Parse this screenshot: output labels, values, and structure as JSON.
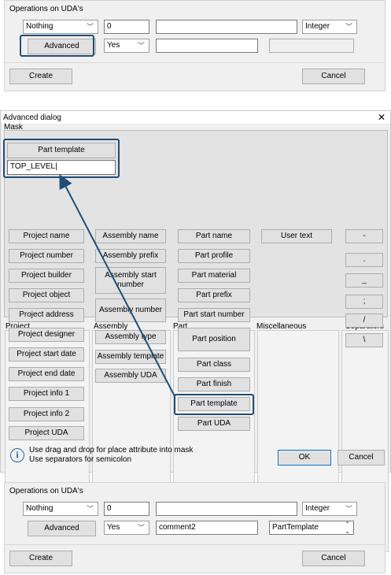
{
  "top_panel": {
    "section_label": "Operations on UDA's",
    "operation_combo": "Nothing",
    "value_input": "0",
    "text_input": "",
    "type_combo": "Integer",
    "advanced_button": "Advanced",
    "yes_combo": "Yes",
    "field2": "",
    "field3": "",
    "create_button": "Create",
    "cancel_button": "Cancel"
  },
  "dialog": {
    "title": "Advanced dialog",
    "close_glyph": "✕",
    "mask_label": "Mask",
    "mask_chip": "Part template",
    "mask_value": "TOP_LEVEL|",
    "columns": {
      "project": {
        "header": "Project",
        "items": [
          "Project name",
          "Project number",
          "Project builder",
          "Project object",
          "Project address",
          "Project designer",
          "Project start date",
          "Project end date",
          "Project info 1",
          "Project info 2",
          "Project UDA"
        ]
      },
      "assembly": {
        "header": "Assembly",
        "items": [
          "Assembly name",
          "Assembly prefix",
          "Assembly start number",
          "Assembly number",
          "Assembly type",
          "Assembly template",
          "Assembly UDA"
        ]
      },
      "part": {
        "header": "Part",
        "items": [
          "Part name",
          "Part profile",
          "Part material",
          "Part prefix",
          "Part start number",
          "Part position",
          "Part class",
          "Part finish",
          "Part template",
          "Part UDA"
        ]
      },
      "misc": {
        "header": "Miscellaneous",
        "items": [
          "User text"
        ]
      },
      "separators": {
        "header": "Separators",
        "items": [
          "-",
          ".",
          "_",
          ";",
          "/",
          "\\"
        ]
      }
    },
    "info_line1": "Use drag and drop for place attribute into mask",
    "info_line2": "Use separators for semicolon",
    "ok_button": "OK",
    "cancel_button": "Cancel"
  },
  "bottom_panel": {
    "section_label": "Operations on UDA's",
    "operation_combo": "Nothing",
    "value_input": "0",
    "text_input": "",
    "type_combo": "Integer",
    "advanced_button": "Advanced",
    "yes_combo": "Yes",
    "field2": "comment2",
    "list_value": "PartTemplate",
    "create_button": "Create",
    "cancel_button": "Cancel"
  },
  "colors": {
    "highlight": "#1f4e79",
    "arrow": "#1f4e79",
    "info_icon": "#1c62b0"
  }
}
